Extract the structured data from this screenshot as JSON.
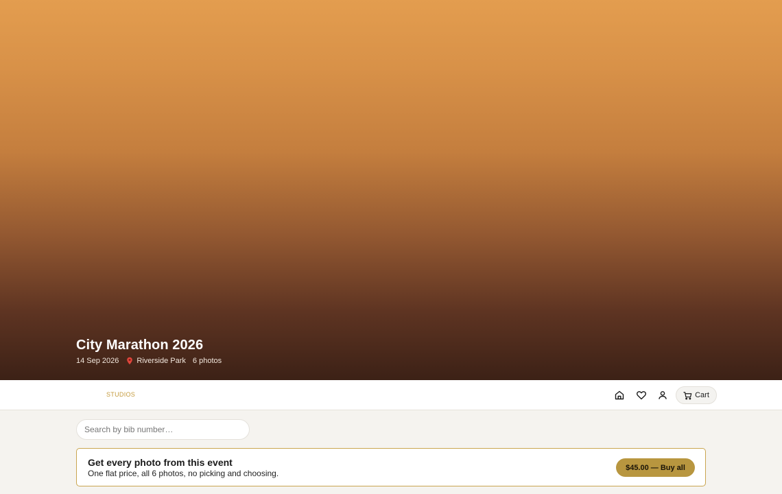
{
  "hero": {
    "title": "City Marathon 2026",
    "date": "14 Sep 2026",
    "location_icon": "map-pin-icon",
    "location": "Riverside Park",
    "photo_count": "6 photos"
  },
  "nav": {
    "brand": "STUDIOS",
    "icons": [
      "home-icon",
      "heart-icon",
      "user-icon"
    ],
    "cart_label": "Cart",
    "cart_icon": "cart-icon"
  },
  "search": {
    "placeholder": "Search by bib number…",
    "value": ""
  },
  "bundle": {
    "title": "Get every photo from this event",
    "subtitle": "One flat price, all 6 photos, no picking and choosing.",
    "button_label": "$45.00 — Buy all"
  },
  "colors": {
    "accent": "#b8963f",
    "brand_text": "#c49a3c",
    "hero_top": "#e39d4f",
    "hero_bottom": "#3c2116"
  }
}
